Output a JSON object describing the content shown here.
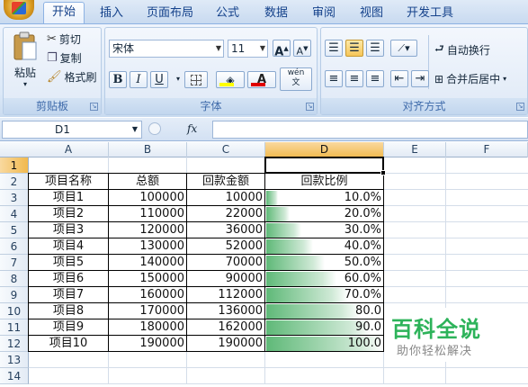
{
  "tabs": [
    "开始",
    "插入",
    "页面布局",
    "公式",
    "数据",
    "审阅",
    "视图",
    "开发工具"
  ],
  "clipboard": {
    "paste": "粘贴",
    "cut": "剪切",
    "copy": "复制",
    "format_painter": "格式刷",
    "label": "剪贴板"
  },
  "font": {
    "name": "宋体",
    "size": "11",
    "bold": "B",
    "italic": "I",
    "underline": "U",
    "label": "字体",
    "grow": "A",
    "shrink": "A",
    "wen": "wén\n文"
  },
  "alignment": {
    "wrap_text": "自动换行",
    "merge_center": "合并后居中",
    "label": "对齐方式"
  },
  "formula_bar": {
    "cell_ref": "D1",
    "fx": "fx",
    "value": ""
  },
  "columns": [
    "A",
    "B",
    "C",
    "D",
    "E",
    "F"
  ],
  "selected_column": "D",
  "rows": [
    "1",
    "2",
    "3",
    "4",
    "5",
    "6",
    "7",
    "8",
    "9",
    "10",
    "11",
    "12",
    "13",
    "14"
  ],
  "selected_row": "1",
  "table": {
    "headers": [
      "项目名称",
      "总额",
      "回款金额",
      "回款比例"
    ],
    "data": [
      [
        "项目1",
        "100000",
        "10000",
        "10.0%",
        0.1
      ],
      [
        "项目2",
        "110000",
        "22000",
        "20.0%",
        0.2
      ],
      [
        "项目3",
        "120000",
        "36000",
        "30.0%",
        0.3
      ],
      [
        "项目4",
        "130000",
        "52000",
        "40.0%",
        0.4
      ],
      [
        "项目5",
        "140000",
        "70000",
        "50.0%",
        0.5
      ],
      [
        "项目6",
        "150000",
        "90000",
        "60.0%",
        0.6
      ],
      [
        "项目7",
        "160000",
        "112000",
        "70.0%",
        0.7
      ],
      [
        "项目8",
        "170000",
        "136000",
        "80.0",
        0.8
      ],
      [
        "项目9",
        "180000",
        "162000",
        "90.0",
        0.9
      ],
      [
        "项目10",
        "190000",
        "190000",
        "100.0",
        1.0
      ]
    ]
  },
  "watermark": {
    "title": "百科全说",
    "subtitle": "助你轻松解决"
  },
  "colors": {
    "databar": "#5fb978",
    "selected_header": "#f1b94e",
    "accent": "#15428b",
    "watermark": "#2db35a"
  }
}
